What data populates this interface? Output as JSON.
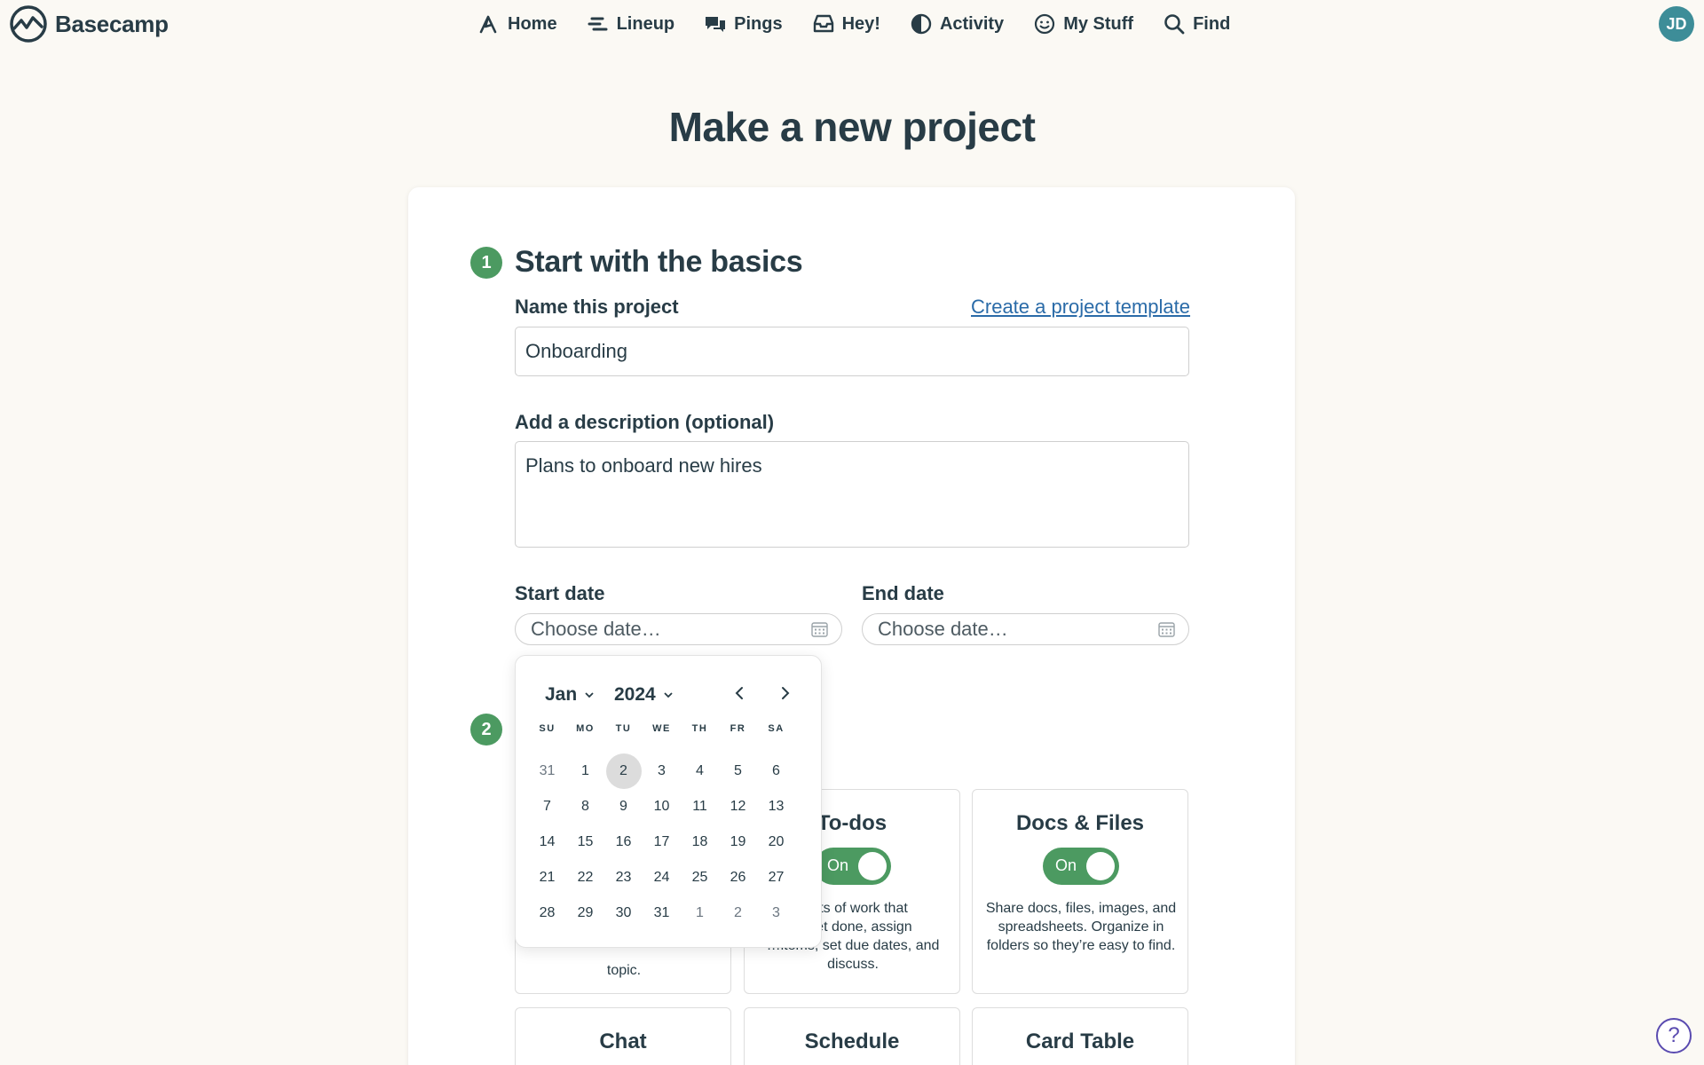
{
  "brand": {
    "name": "Basecamp"
  },
  "nav": {
    "items": [
      {
        "label": "Home",
        "icon": "home-icon"
      },
      {
        "label": "Lineup",
        "icon": "lineup-icon"
      },
      {
        "label": "Pings",
        "icon": "pings-icon"
      },
      {
        "label": "Hey!",
        "icon": "inbox-icon"
      },
      {
        "label": "Activity",
        "icon": "activity-icon"
      },
      {
        "label": "My Stuff",
        "icon": "smiley-icon"
      },
      {
        "label": "Find",
        "icon": "search-icon"
      }
    ],
    "avatar_initials": "JD"
  },
  "page": {
    "title": "Make a new project"
  },
  "step1": {
    "number": "1",
    "title": "Start with the basics",
    "name_label": "Name this project",
    "template_link": "Create a project template",
    "name_value": "Onboarding",
    "desc_label": "Add a description (optional)",
    "desc_value": "Plans to onboard new hires",
    "start_label": "Start date",
    "end_label": "End date",
    "start_placeholder": "Choose date…",
    "end_placeholder": "Choose date…"
  },
  "step2": {
    "number": "2"
  },
  "tools": [
    {
      "title": "To-dos",
      "toggle": "On",
      "desc": "…sts of work that\n…get done, assign\n…items, set due dates, and\ndiscuss."
    },
    {
      "title": "Docs & Files",
      "toggle": "On",
      "desc": "Share docs, files, images, and spreadsheets. Organize in folders so they’re easy to find."
    },
    {
      "title": "Chat"
    },
    {
      "title": "Schedule"
    },
    {
      "title": "Card Table"
    }
  ],
  "hidden_card_desc_tail": "topic.",
  "datepicker": {
    "month": "Jan",
    "year": "2024",
    "weekdays": [
      "SU",
      "MO",
      "TU",
      "WE",
      "TH",
      "FR",
      "SA"
    ],
    "weeks": [
      [
        "31",
        "1",
        "2",
        "3",
        "4",
        "5",
        "6"
      ],
      [
        "7",
        "8",
        "9",
        "10",
        "11",
        "12",
        "13"
      ],
      [
        "14",
        "15",
        "16",
        "17",
        "18",
        "19",
        "20"
      ],
      [
        "21",
        "22",
        "23",
        "24",
        "25",
        "26",
        "27"
      ],
      [
        "28",
        "29",
        "30",
        "31",
        "1",
        "2",
        "3"
      ]
    ],
    "selected": "2"
  },
  "help": {
    "label": "?"
  },
  "colors": {
    "accent_green": "#4c9a61",
    "link_blue": "#2a6ba8",
    "text": "#283c46",
    "background": "#fbf9f4"
  }
}
